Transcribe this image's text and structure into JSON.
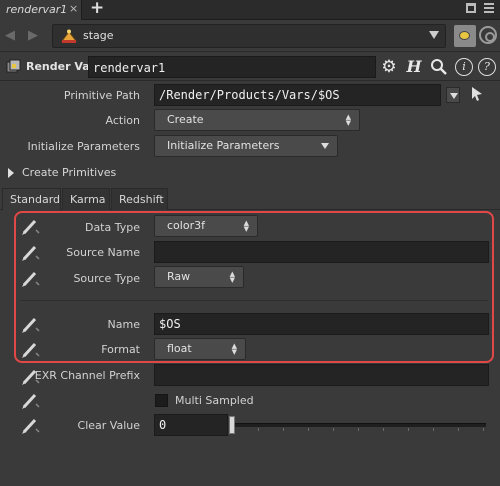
{
  "tab": {
    "title": "rendervar1",
    "close": "×",
    "add": "+"
  },
  "path": {
    "text": "stage"
  },
  "node": {
    "type_label": "Render Var",
    "name": "rendervar1"
  },
  "params": {
    "primitive_path": {
      "label": "Primitive Path",
      "value": "/Render/Products/Vars/$OS"
    },
    "action": {
      "label": "Action",
      "value": "Create"
    },
    "init_params": {
      "label": "Initialize Parameters",
      "value": "Initialize Parameters"
    },
    "create_primitives": {
      "label": "Create Primitives"
    }
  },
  "tabs": [
    {
      "label": "Standard"
    },
    {
      "label": "Karma"
    },
    {
      "label": "Redshift"
    }
  ],
  "standard": {
    "data_type": {
      "label": "Data Type",
      "value": "color3f"
    },
    "source_name": {
      "label": "Source Name",
      "value": ""
    },
    "source_type": {
      "label": "Source Type",
      "value": "Raw"
    },
    "name": {
      "label": "Name",
      "value": "$OS"
    },
    "format": {
      "label": "Format",
      "value": "float"
    },
    "exr_prefix": {
      "label": "EXR Channel Prefix",
      "value": ""
    },
    "multi_sampled": {
      "label": "Multi Sampled",
      "checked": false
    },
    "clear_value": {
      "label": "Clear Value",
      "value": "0"
    }
  },
  "colors": {
    "highlight": "#e04848",
    "pin_accent": "#e8c642"
  },
  "icons": [
    "chevron-left-icon",
    "chevron-right-icon",
    "stage-icon",
    "pin-icon",
    "link-icon",
    "render-var-node-icon",
    "gear-icon",
    "help-h-icon",
    "search-icon",
    "info-icon",
    "help-icon",
    "pen-icon",
    "pointer-icon"
  ]
}
